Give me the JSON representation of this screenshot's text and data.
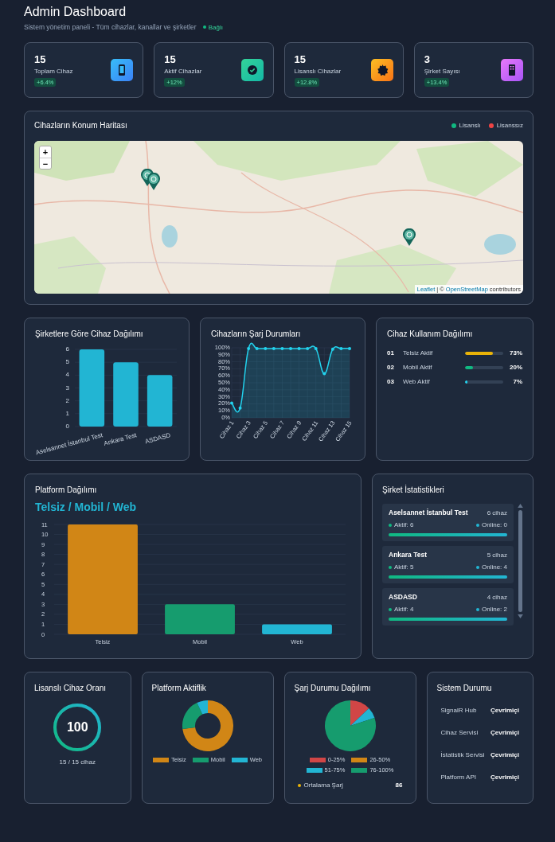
{
  "header": {
    "title": "Admin Dashboard",
    "subtitle": "Sistem yönetim paneli - Tüm cihazlar, kanallar ve şirketler",
    "connection": {
      "label": "Bağlı",
      "on": true
    }
  },
  "stats": [
    {
      "value": "15",
      "label": "Toplam Cihaz",
      "change": "+6.4%"
    },
    {
      "value": "15",
      "label": "Aktif Cihazlar",
      "change": "+12%"
    },
    {
      "value": "15",
      "label": "Lisanslı Cihazlar",
      "change": "+12.8%"
    },
    {
      "value": "3",
      "label": "Şirket Sayısı",
      "change": "+13.4%"
    }
  ],
  "map": {
    "title": "Cihazların Konum Haritası",
    "legend": [
      {
        "label": "Lisanslı",
        "color": "#10b981"
      },
      {
        "label": "Lisanssız",
        "color": "#ef4444"
      }
    ],
    "zoom_in": "+",
    "zoom_out": "−",
    "attribution": {
      "library": "Leaflet",
      "separator": "| ©",
      "source": "OpenStreetMap",
      "suffix": "contributors"
    }
  },
  "company_devices": {
    "title": "Şirketlere Göre Cihaz Dağılımı",
    "chart_data": {
      "type": "bar",
      "categories": [
        "Aselsannet İstanbul Test",
        "Ankara Test",
        "ASDASD"
      ],
      "values": [
        6,
        5,
        4
      ],
      "grid": true,
      "ylim": [
        0,
        6
      ],
      "yticks": [
        0,
        1,
        2,
        3,
        4,
        5,
        6
      ]
    }
  },
  "charge_levels": {
    "title": "Cihazların Şarj Durumları",
    "chart_data": {
      "type": "area",
      "categories": [
        "Cihaz 1",
        null,
        "Cihaz 3",
        null,
        "Cihaz 5",
        null,
        "Cihaz 7",
        null,
        "Cihaz 9",
        null,
        "Cihaz 11",
        null,
        "Cihaz 13",
        null,
        "Cihaz 15"
      ],
      "values": [
        21,
        14,
        99,
        99,
        99,
        99,
        99,
        99,
        99,
        99,
        99,
        63,
        98,
        99,
        99
      ],
      "grid": true,
      "ylim": [
        0,
        100
      ],
      "yticks": [
        {
          "value": 0,
          "label": "0%"
        },
        {
          "value": 10,
          "label": "10%"
        },
        {
          "value": 20,
          "label": "20%"
        },
        {
          "value": 30,
          "label": "30%"
        },
        {
          "value": 40,
          "label": "40%"
        },
        {
          "value": 50,
          "label": "50%"
        },
        {
          "value": 60,
          "label": "60%"
        },
        {
          "value": 70,
          "label": "70%"
        },
        {
          "value": 80,
          "label": "80%"
        },
        {
          "value": 90,
          "label": "90%"
        },
        {
          "value": 100,
          "label": "100%"
        }
      ]
    }
  },
  "usage": {
    "title": "Cihaz Kullanım Dağılımı",
    "items": [
      {
        "rank": "01",
        "label": "Telsiz Aktif",
        "level": 0.73,
        "value": "73%",
        "color": "#eab308"
      },
      {
        "rank": "02",
        "label": "Mobil Aktif",
        "level": 0.2,
        "value": "20%",
        "color": "#10b981"
      },
      {
        "rank": "03",
        "label": "Web Aktif",
        "level": 0.07,
        "value": "7%",
        "color": "#22d3ee"
      }
    ]
  },
  "platform": {
    "title": "Platform Dağılımı",
    "headline": "Telsiz / Mobil / Web",
    "chart_data": {
      "type": "bar",
      "categories": [
        "Telsiz",
        "Mobil",
        "Web"
      ],
      "values": [
        11,
        3,
        1
      ],
      "grid": true,
      "ylim": [
        0,
        11
      ],
      "yticks": [
        0,
        1,
        2,
        3,
        4,
        5,
        6,
        7,
        8,
        9,
        10,
        11
      ]
    }
  },
  "company_stats": {
    "title": "Şirket İstatistikleri",
    "items": [
      {
        "name": "Aselsannet İstanbul Test",
        "devices": "6 cihaz",
        "active": "Aktif: 6",
        "online": "Online: 0",
        "level": 1
      },
      {
        "name": "Ankara Test",
        "devices": "5 cihaz",
        "active": "Aktif: 5",
        "online": "Online: 4",
        "level": 1
      },
      {
        "name": "ASDASD",
        "devices": "4 cihaz",
        "active": "Aktif: 4",
        "online": "Online: 2",
        "level": 1
      }
    ]
  },
  "license_ratio": {
    "title": "Lisanslı Cihaz Oranı",
    "value": "100",
    "level": 1,
    "caption": "15 / 15 cihaz"
  },
  "platform_activity": {
    "title": "Platform Aktiflik",
    "chart_data": {
      "type": "donut",
      "categories": [
        "Telsiz",
        "Mobil",
        "Web"
      ],
      "values": [
        73,
        20,
        7
      ],
      "legend": "bottom"
    }
  },
  "charge_distribution": {
    "title": "Şarj Durumu Dağılımı",
    "chart_data": {
      "type": "pie",
      "categories": [
        "0-25%",
        "26-50%",
        "51-75%",
        "76-100%"
      ],
      "values": [
        13,
        0,
        7,
        80
      ],
      "legend": "bottom"
    },
    "average": {
      "label": "Ortalama Şarj",
      "value": "86"
    }
  },
  "system_status": {
    "title": "Sistem Durumu",
    "items": [
      {
        "name": "SignalR Hub",
        "status": "Çevrimiçi"
      },
      {
        "name": "Cihaz Servisi",
        "status": "Çevrimiçi"
      },
      {
        "name": "İstatistik Servisi",
        "status": "Çevrimiçi"
      },
      {
        "name": "Platform API",
        "status": "Çevrimiçi"
      }
    ]
  }
}
